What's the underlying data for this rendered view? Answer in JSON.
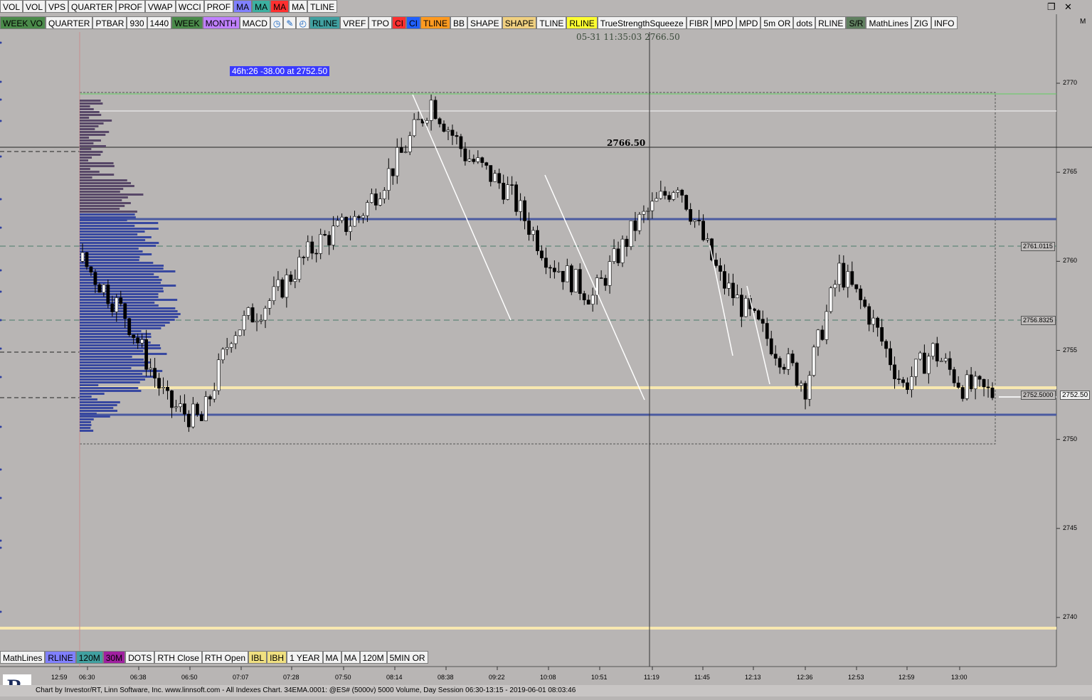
{
  "toolbar_top": [
    "VOL",
    "VOL",
    "VPS",
    "QUARTER",
    "PROF",
    "VWAP",
    "WCCI",
    "PROF",
    "MA",
    "MA",
    "MA",
    "MA",
    "TLINE"
  ],
  "toolbar_top_colors": [
    "#f2f2f2",
    "#f2f2f2",
    "#f2f2f2",
    "#f2f2f2",
    "#f2f2f2",
    "#f2f2f2",
    "#f2f2f2",
    "#f2f2f2",
    "#8080ff",
    "#3cb0a0",
    "#ff3030",
    "#f2f2f2",
    "#f2f2f2"
  ],
  "toolbar_second": [
    "WEEK VO",
    "QUARTER",
    "PTBAR",
    "930",
    "1440",
    "WEEK",
    "MONTH",
    "MACD",
    "clock-icon",
    "pencil-icon",
    "timer-icon",
    "RLINE",
    "VREF",
    "TPO",
    "CI",
    "CI",
    "TLINE",
    "BB",
    "SHAPE",
    "SHAPE",
    "TLINE",
    "RLINE",
    "TrueStrengthSqueeze",
    "FIBR",
    "MPD",
    "MPD",
    "5m OR",
    "dots",
    "RLINE",
    "S/R",
    "MathLines",
    "ZIG",
    "INFO"
  ],
  "toolbar_second_colors": [
    "#4a8a4a",
    "#f2f2f2",
    "#f2f2f2",
    "#f2f2f2",
    "#f2f2f2",
    "#4a8a4a",
    "#c080ff",
    "#f2f2f2",
    "#f2f2f2",
    "#f2f2f2",
    "#f2f2f2",
    "#40a0a0",
    "#f2f2f2",
    "#f2f2f2",
    "#ff3030",
    "#2060ff",
    "#ff9a20",
    "#f2f2f2",
    "#f2f2f2",
    "#f0d080",
    "#f2f2f2",
    "#ffff30",
    "#f2f2f2",
    "#f2f2f2",
    "#f2f2f2",
    "#f2f2f2",
    "#f2f2f2",
    "#f2f2f2",
    "#f2f2f2",
    "#608060",
    "#f2f2f2",
    "#f2f2f2",
    "#f2f2f2"
  ],
  "toolbar_bottom": [
    "MathLines",
    "RLINE",
    "120M",
    "30M",
    "DOTS",
    "RTH Close",
    "RTH Open",
    "IBL",
    "IBH",
    "1 YEAR",
    "MA",
    "MA",
    "120M",
    "5MIN OR"
  ],
  "toolbar_bottom_colors": [
    "#f2f2f2",
    "#8080ff",
    "#40a0a0",
    "#a020a0",
    "#f2f2f2",
    "#f2f2f2",
    "#f2f2f2",
    "#f0e080",
    "#f0e080",
    "#f2f2f2",
    "#f2f2f2",
    "#f2f2f2",
    "#f2f2f2",
    "#f2f2f2"
  ],
  "info_box": "46h:26  -38.00 at 2752.50",
  "crosshair_readout": "05-31 11:35:03  2766.50",
  "level_label": "2766.50",
  "price_axis": [
    "2770",
    "2765",
    "2760",
    "2755",
    "2750",
    "2745",
    "2740"
  ],
  "right_tags": [
    {
      "text": "2761.0115",
      "price": 2760.85
    },
    {
      "text": "2756.8325",
      "price": 2756.7
    },
    {
      "text": "2752.5000",
      "price": 2752.5
    }
  ],
  "last_price_tag": "2752.50",
  "time_axis": [
    "12:59",
    "06:30",
    "06:38",
    "06:50",
    "07:07",
    "07:28",
    "07:50",
    "08:14",
    "08:38",
    "09:22",
    "10:08",
    "10:51",
    "11:19",
    "11:45",
    "12:13",
    "12:36",
    "12:53",
    "12:59",
    "13:00"
  ],
  "status_text": "Chart by Investor/RT, Linn Software, Inc. www.linnsoft.com - All Indexes Chart. 34EMA.0001: @ES# (5000v) 5000 Volume, Day Session 06:30-13:15 - 2019-06-01 08:03:46",
  "m_mark": "M",
  "colors": {
    "bg": "#b8b5b4",
    "blue_line": "#4a5aa0",
    "yellow_line": "#f8e8b0",
    "green_line": "#60d060",
    "profile": "#3848a0",
    "profile_top": "#584868"
  }
}
